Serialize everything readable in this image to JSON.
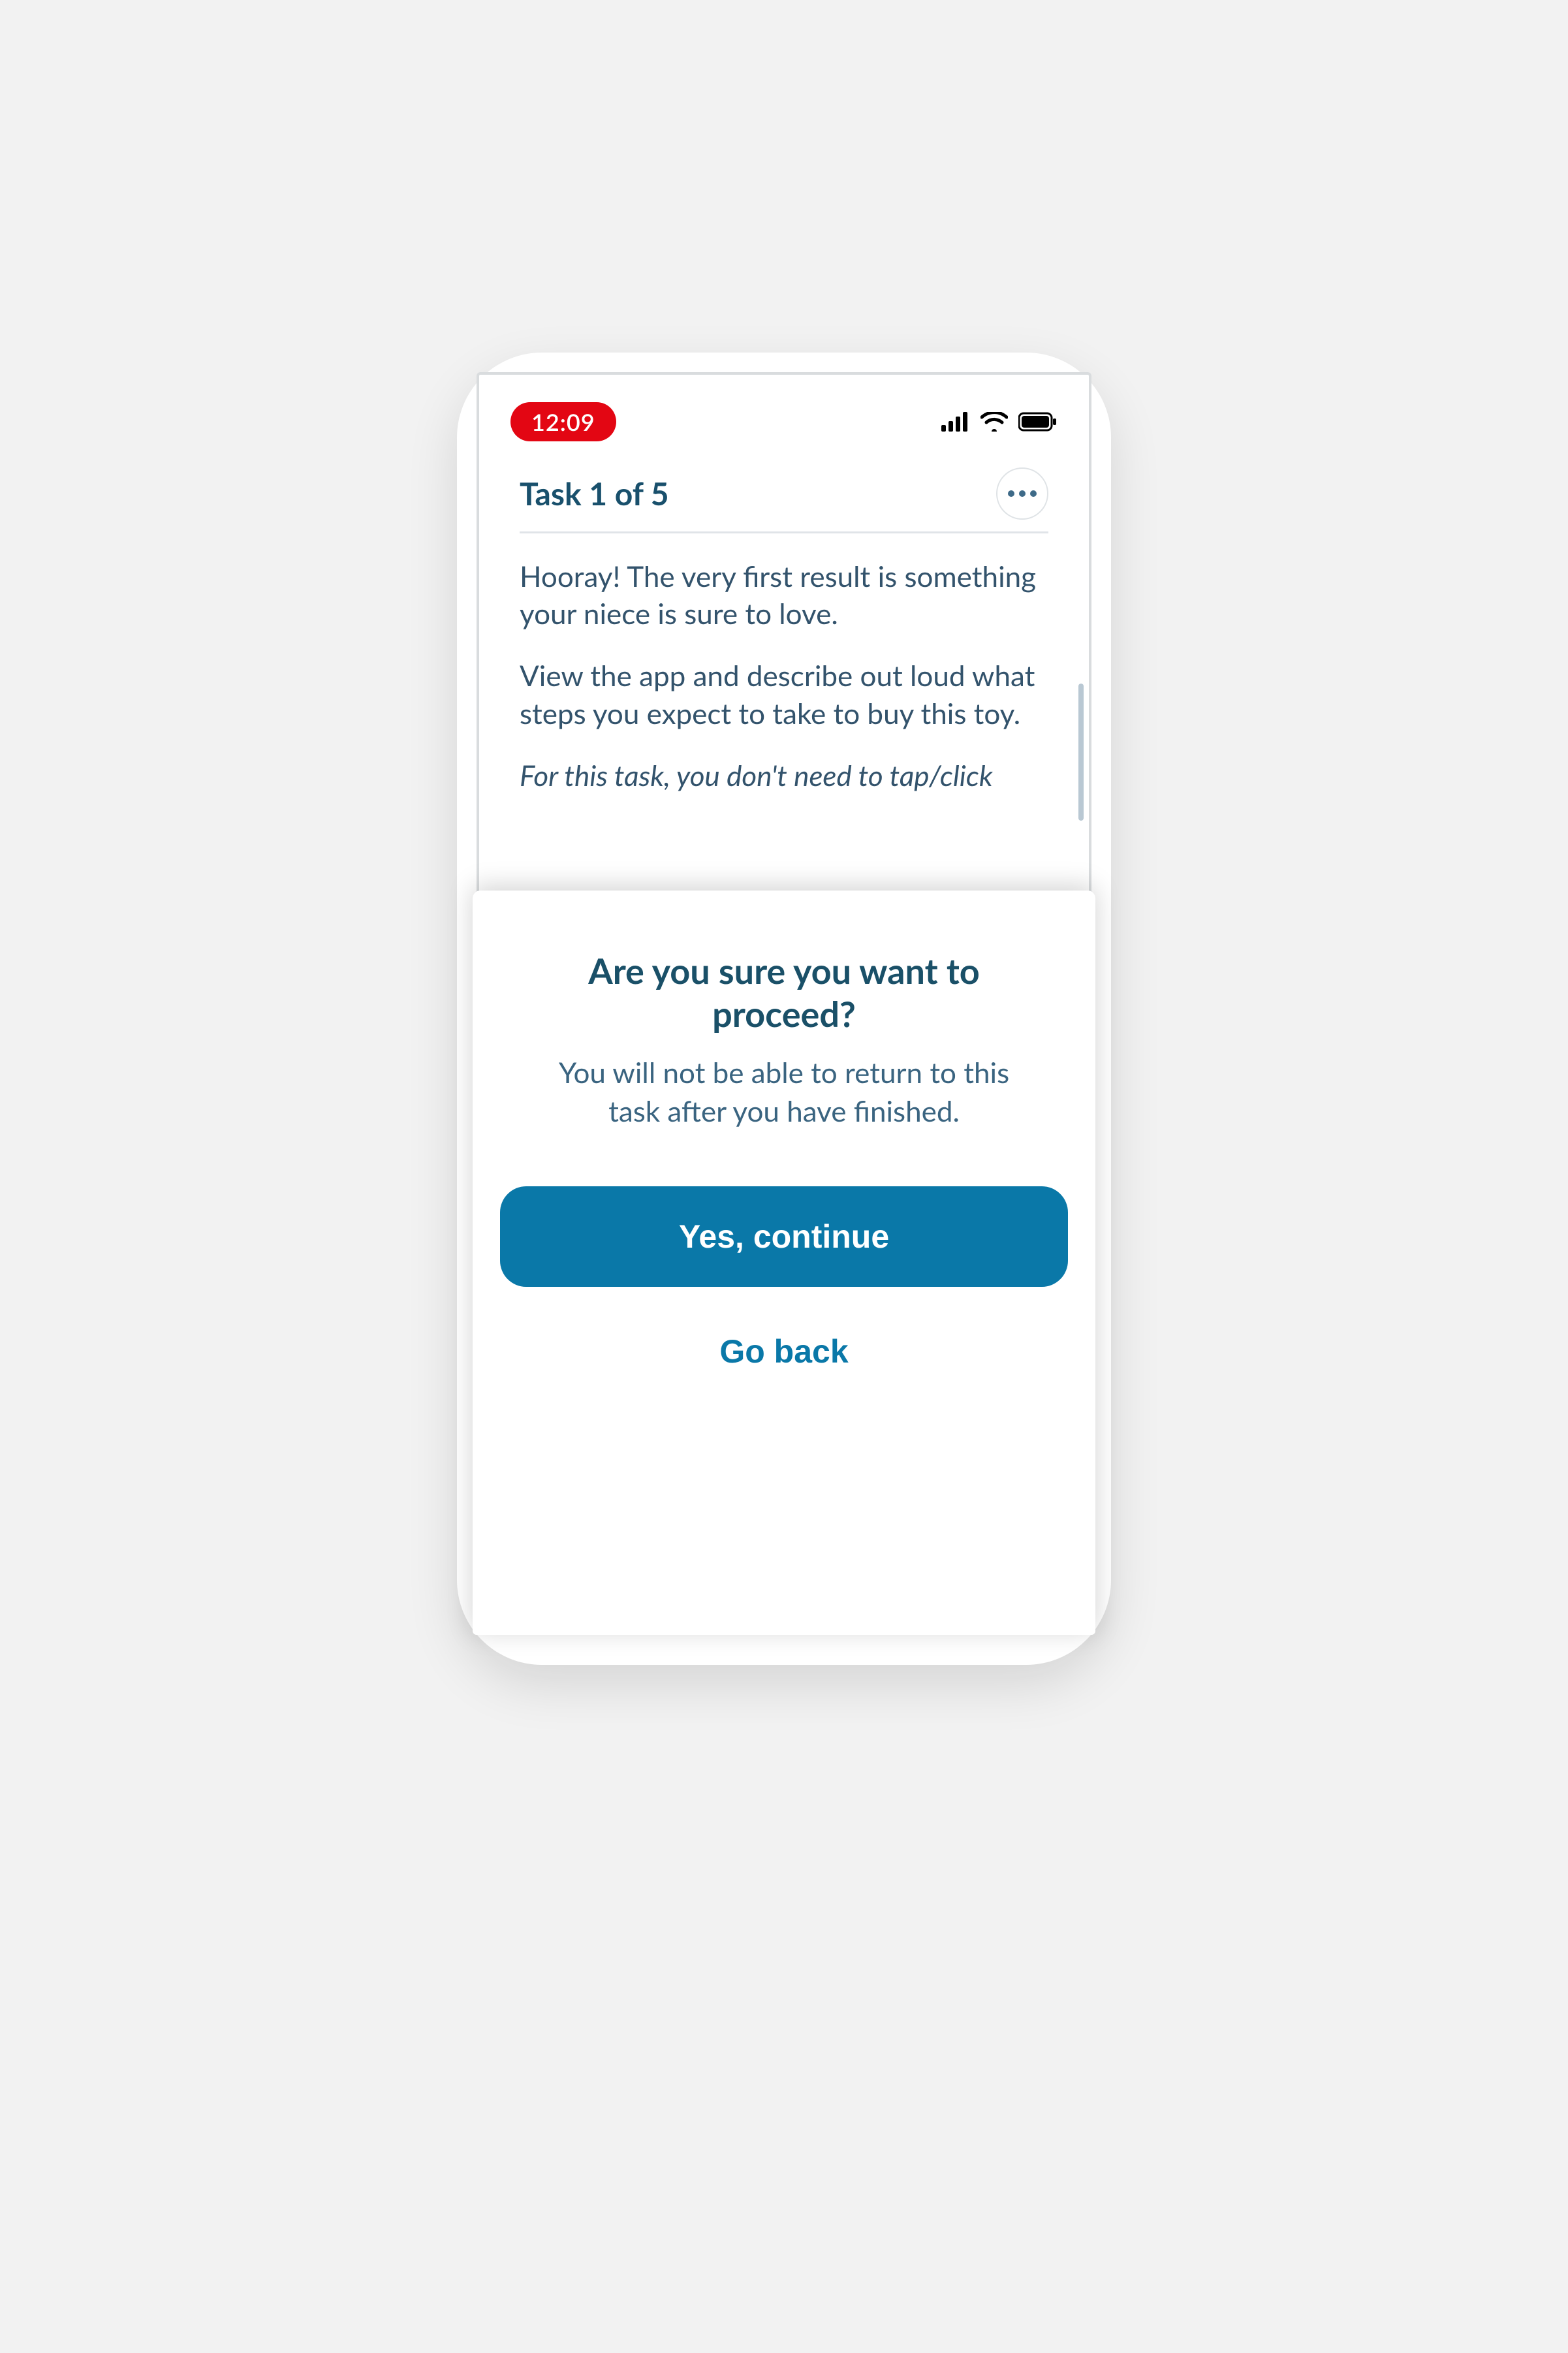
{
  "status_bar": {
    "time": "12:09"
  },
  "task": {
    "header_title": "Task 1 of 5",
    "paragraph1": "Hooray! The very first result is something your niece is sure to love.",
    "paragraph2": "View the app and describe out loud what steps you expect to take to buy this toy.",
    "paragraph3": "For this task, you don't need to tap/click"
  },
  "modal": {
    "title": "Are you sure you want to proceed?",
    "subtitle": "You will not be able to return to this task after you have finished.",
    "primary_button": "Yes, continue",
    "secondary_button": "Go back"
  }
}
